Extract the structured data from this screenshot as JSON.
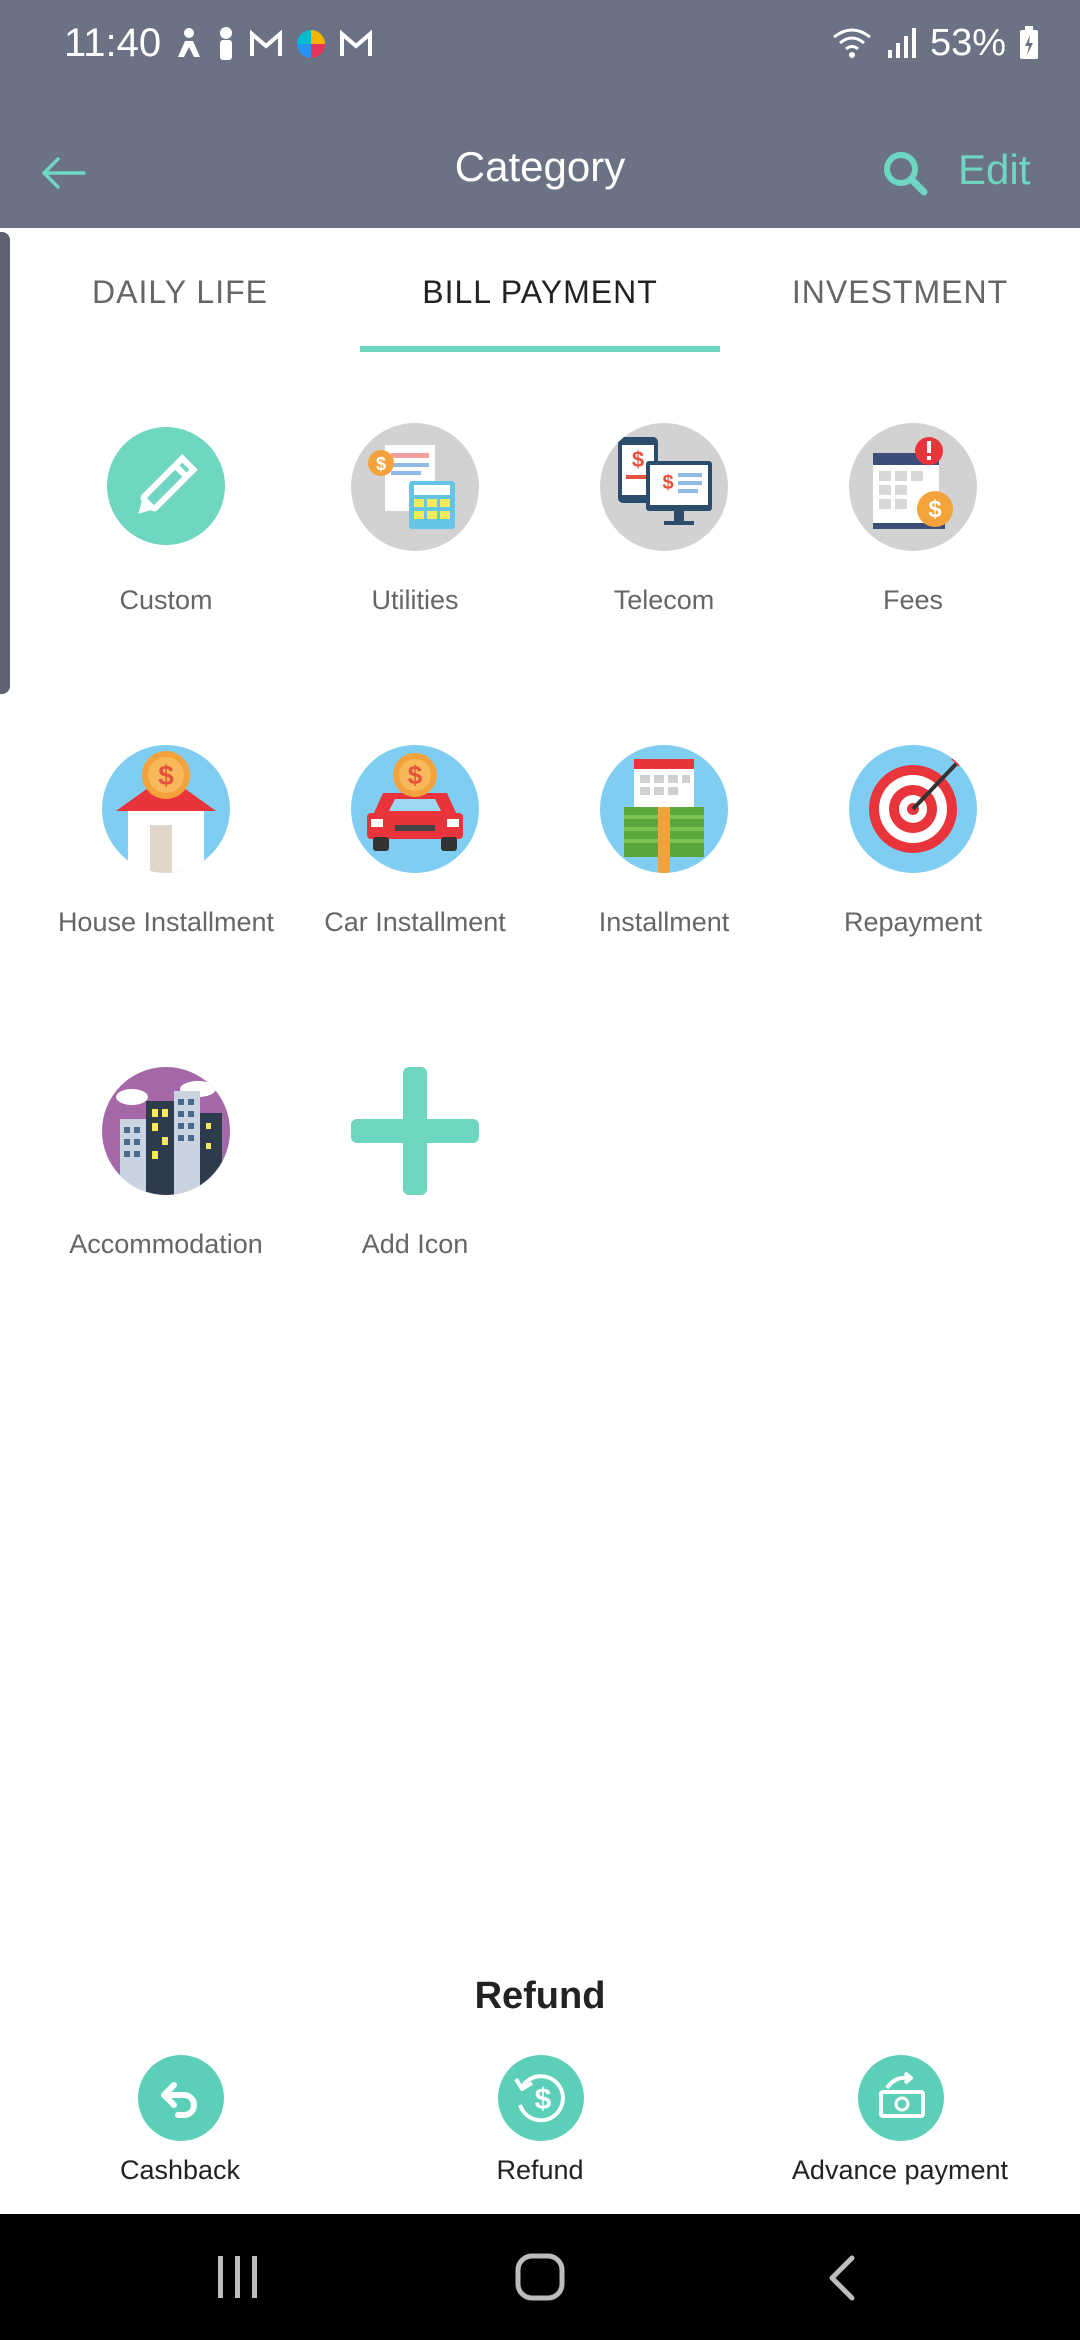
{
  "status_bar": {
    "time": "11:40",
    "battery": "53%",
    "icons": [
      "accessibility-icon",
      "pen-icon",
      "gmail-icon",
      "colorful-app-icon",
      "gmail-icon",
      "wifi-icon",
      "signal-icon",
      "battery-icon"
    ]
  },
  "app_bar": {
    "title": "Category",
    "edit_label": "Edit"
  },
  "tabs": [
    {
      "label": "DAILY LIFE",
      "active": false
    },
    {
      "label": "BILL PAYMENT",
      "active": true
    },
    {
      "label": "INVESTMENT",
      "active": false
    }
  ],
  "categories": [
    {
      "label": "Custom",
      "icon": "pencil-icon"
    },
    {
      "label": "Utilities",
      "icon": "utilities-bill-icon"
    },
    {
      "label": "Telecom",
      "icon": "telecom-devices-icon"
    },
    {
      "label": "Fees",
      "icon": "fees-calendar-icon"
    },
    {
      "label": "House Installment",
      "icon": "house-coin-icon"
    },
    {
      "label": "Car Installment",
      "icon": "car-coin-icon"
    },
    {
      "label": "Installment",
      "icon": "installment-calendar-money-icon"
    },
    {
      "label": "Repayment",
      "icon": "target-dart-icon"
    },
    {
      "label": "Accommodation",
      "icon": "city-buildings-icon"
    },
    {
      "label": "Add Icon",
      "icon": "plus-icon"
    }
  ],
  "sheet": {
    "title": "Refund",
    "actions": [
      {
        "label": "Cashback",
        "icon": "undo-arrow-icon"
      },
      {
        "label": "Refund",
        "icon": "refund-dollar-icon"
      },
      {
        "label": "Advance payment",
        "icon": "advance-cash-icon"
      }
    ]
  },
  "colors": {
    "header": "#6b7283",
    "accent": "#6fd6c2",
    "accent_button": "#5ccfb8",
    "icon_bg_gray": "#d2d2d2",
    "icon_bg_blue": "#7fcdf0",
    "icon_bg_purple": "#a569a9"
  }
}
